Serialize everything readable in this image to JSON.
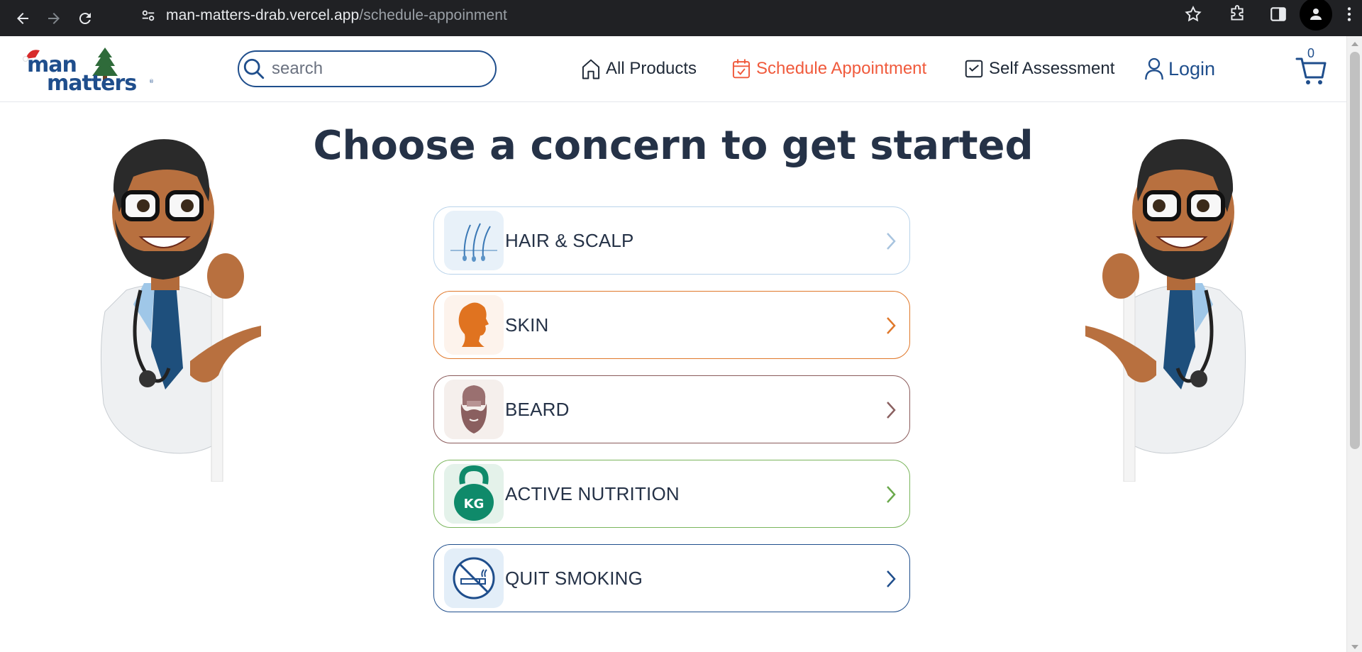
{
  "browser": {
    "url_host": "man-matters-drab.vercel.app",
    "url_path": "/schedule-appoinment"
  },
  "header": {
    "logo_text": "man matters",
    "search_placeholder": "search",
    "nav": {
      "all_products": "All Products",
      "schedule_appointment": "Schedule Appointment",
      "self_assessment": "Self Assessment",
      "login": "Login"
    },
    "cart_count": "0"
  },
  "main": {
    "title": "Choose a concern to get started",
    "concerns": [
      {
        "label": "HAIR & SCALP",
        "icon": "hair-follicle-icon",
        "color": "#b9d3ea",
        "chevron_color": "#a8c4df",
        "icon_bg": "#e8f1f9"
      },
      {
        "label": "SKIN",
        "icon": "face-profile-icon",
        "color": "#e0782a",
        "chevron_color": "#e0782a",
        "icon_bg": "#fdf3ec"
      },
      {
        "label": "BEARD",
        "icon": "beard-icon",
        "color": "#8a5a5a",
        "chevron_color": "#8a6060",
        "icon_bg": "#f5efec"
      },
      {
        "label": "ACTIVE NUTRITION",
        "icon": "kettlebell-icon",
        "color": "#7ab55c",
        "chevron_color": "#6aa94b",
        "icon_bg": "#e4f2ea"
      },
      {
        "label": "QUIT SMOKING",
        "icon": "no-smoking-icon",
        "color": "#1f4e8c",
        "chevron_color": "#1f4e8c",
        "icon_bg": "#e3eef8"
      }
    ]
  },
  "colors": {
    "brand_blue": "#1f4e8c",
    "accent_orange": "#f05a3c",
    "title_text": "#253247"
  }
}
